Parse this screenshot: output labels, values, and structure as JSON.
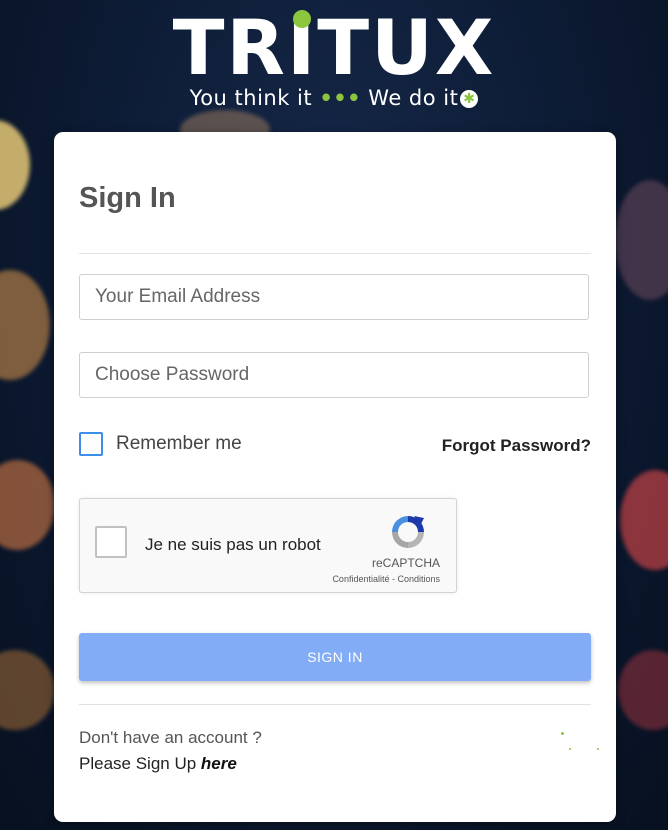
{
  "logo": {
    "wordmark_pre": "TR",
    "wordmark_i": "I",
    "wordmark_post": "TUX",
    "tagline_a": "You think it",
    "tagline_dots": "•••",
    "tagline_b": "We do it",
    "tagline_star": "✱"
  },
  "form": {
    "title": "Sign In",
    "email_placeholder": "Your Email Address",
    "password_placeholder": "Choose Password",
    "remember_label": "Remember me",
    "forgot_label": "Forgot Password?",
    "signin_label": "SIGN IN"
  },
  "recaptcha": {
    "label": "Je ne suis pas un robot",
    "brand": "reCAPTCHA",
    "links": "Confidentialité - Conditions"
  },
  "footer": {
    "no_account": "Don't have an account ?",
    "signup_prefix": "Please Sign Up ",
    "signup_link": "here"
  },
  "colors": {
    "brand_green": "#8cc63f",
    "button_blue": "#82acf5",
    "checkbox_blue": "#3d8ee8",
    "background_navy": "#0c1a33"
  }
}
